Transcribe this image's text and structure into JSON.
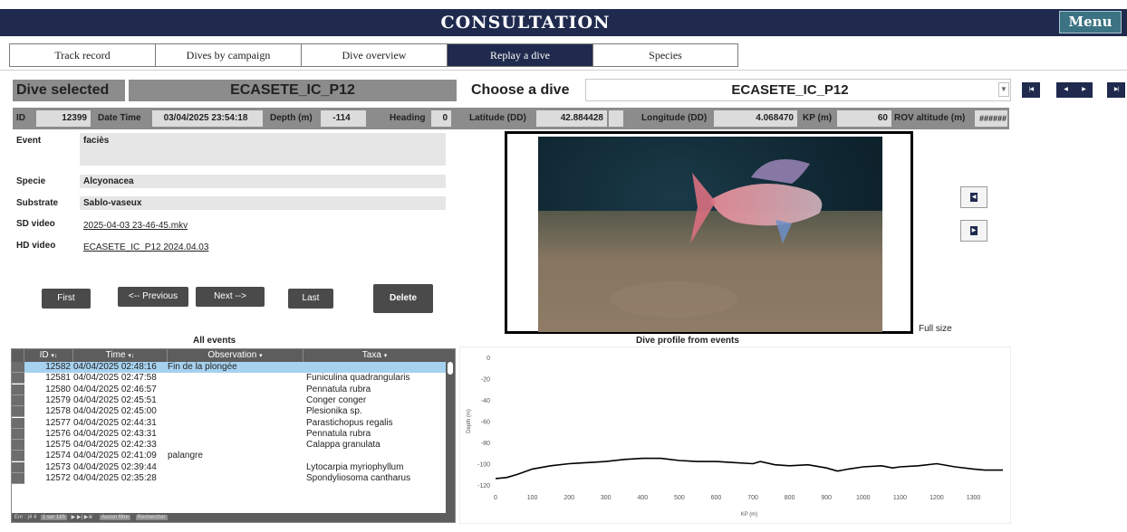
{
  "app": {
    "title": "CONSULTATION",
    "menu_label": "Menu"
  },
  "tabs": [
    {
      "label": "Track record",
      "active": false
    },
    {
      "label": "Dives by campaign",
      "active": false
    },
    {
      "label": "Dive overview",
      "active": false
    },
    {
      "label": "Replay a dive",
      "active": true
    },
    {
      "label": "Species",
      "active": false
    }
  ],
  "dive_selected": {
    "label": "Dive selected",
    "value": "ECASETE_IC_P12"
  },
  "choose_dive": {
    "label": "Choose a dive",
    "value": "ECASETE_IC_P12"
  },
  "nav_icons": [
    "first-record-icon",
    "previous-record-icon",
    "next-record-icon",
    "last-record-icon"
  ],
  "info": {
    "id_label": "ID",
    "id": "12399",
    "datetime_label": "Date Time",
    "datetime": "03/04/2025 23:54:18",
    "depth_label": "Depth (m)",
    "depth": "-114",
    "heading_label": "Heading",
    "heading": "0",
    "lat_label": "Latitude (DD)",
    "lat": "42.884428",
    "lon_label": "Longitude (DD)",
    "lon": "4.068470",
    "kp_label": "KP (m)",
    "kp": "60",
    "rov_label": "ROV altitude (m)",
    "rov": "######"
  },
  "details": {
    "event_label": "Event",
    "event": "faciès",
    "specie_label": "Specie",
    "specie": "Alcyonacea",
    "substrate_label": "Substrate",
    "substrate": "Sablo-vaseux",
    "sd_label": "SD video",
    "sd": "2025-04-03 23-46-45.mkv",
    "hd_label": "HD video",
    "hd": "ECASETE_IC_P12 2024.04.03"
  },
  "buttons": {
    "first": "First",
    "previous": "<-- Previous",
    "next": "Next -->",
    "last": "Last",
    "delete": "Delete"
  },
  "video": {
    "fullsize": "Full size"
  },
  "events": {
    "title": "All events",
    "columns": [
      "ID",
      "Time",
      "Observation",
      "Taxa"
    ],
    "rows": [
      {
        "id": "12582",
        "time": "04/04/2025 02:48:16",
        "obs": "Fin de la plongée",
        "taxa": ""
      },
      {
        "id": "12581",
        "time": "04/04/2025 02:47:58",
        "obs": "",
        "taxa": "Funiculina quadrangularis"
      },
      {
        "id": "12580",
        "time": "04/04/2025 02:46:57",
        "obs": "",
        "taxa": "Pennatula rubra"
      },
      {
        "id": "12579",
        "time": "04/04/2025 02:45:51",
        "obs": "",
        "taxa": "Conger conger"
      },
      {
        "id": "12578",
        "time": "04/04/2025 02:45:00",
        "obs": "",
        "taxa": "Plesionika sp."
      },
      {
        "id": "12577",
        "time": "04/04/2025 02:44:31",
        "obs": "",
        "taxa": "Parastichopus regalis"
      },
      {
        "id": "12576",
        "time": "04/04/2025 02:43:31",
        "obs": "",
        "taxa": "Pennatula rubra"
      },
      {
        "id": "12575",
        "time": "04/04/2025 02:42:33",
        "obs": "",
        "taxa": "Calappa granulata"
      },
      {
        "id": "12574",
        "time": "04/04/2025 02:41:09",
        "obs": "palangre",
        "taxa": ""
      },
      {
        "id": "12573",
        "time": "04/04/2025 02:39:44",
        "obs": "",
        "taxa": "Lytocarpia myriophyllum"
      },
      {
        "id": "12572",
        "time": "04/04/2025 02:35:28",
        "obs": "",
        "taxa": "Spondyliosoma cantharus"
      }
    ],
    "record_nav": {
      "prefix": "Enr : |4 4",
      "position": "1 sur 185",
      "controls": "▶ ▶| ▶※",
      "filter": "Aucun filtre",
      "search": "Rechercher"
    }
  },
  "chart_data": {
    "type": "line",
    "title": "Dive profile from events",
    "xlabel": "KP (m)",
    "ylabel": "Depth (m)",
    "xlim": [
      0,
      1380
    ],
    "ylim": [
      -120,
      0
    ],
    "xticks": [
      0,
      100,
      200,
      300,
      400,
      500,
      600,
      700,
      800,
      900,
      1000,
      1100,
      1200,
      1300
    ],
    "yticks": [
      0,
      -20,
      -40,
      -60,
      -80,
      -100,
      -120
    ],
    "grid": false,
    "series": [
      {
        "color": "#000000",
        "x": [
          0,
          30,
          60,
          100,
          150,
          200,
          250,
          300,
          350,
          400,
          450,
          500,
          550,
          600,
          650,
          700,
          720,
          760,
          800,
          850,
          900,
          930,
          960,
          1000,
          1050,
          1080,
          1100,
          1150,
          1200,
          1250,
          1300,
          1330,
          1380
        ],
        "y": [
          -114,
          -113,
          -110,
          -105,
          -102,
          -100,
          -99,
          -98,
          -96,
          -95,
          -95,
          -97,
          -98,
          -98,
          -99,
          -100,
          -98,
          -101,
          -102,
          -101,
          -104,
          -107,
          -105,
          -103,
          -102,
          -104,
          -103,
          -102,
          -100,
          -103,
          -105,
          -106,
          -106
        ]
      }
    ]
  }
}
